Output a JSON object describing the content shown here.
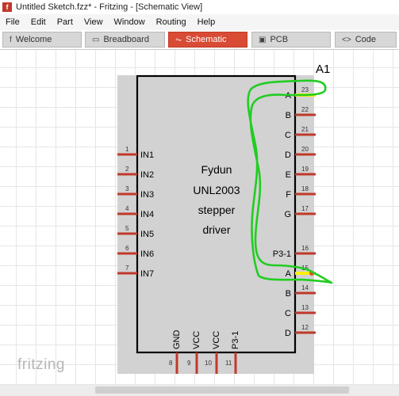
{
  "window": {
    "title": "Untitled Sketch.fzz* - Fritzing - [Schematic View]",
    "icon": "fritzing-icon"
  },
  "menu": [
    "File",
    "Edit",
    "Part",
    "View",
    "Window",
    "Routing",
    "Help"
  ],
  "tabs": [
    {
      "label": "Welcome",
      "icon": "f"
    },
    {
      "label": "Breadboard",
      "icon": "▭"
    },
    {
      "label": "Schematic",
      "icon": "⏦"
    },
    {
      "label": "PCB",
      "icon": "▣"
    },
    {
      "label": "Code",
      "icon": "<>"
    }
  ],
  "active_tab": "Schematic",
  "part": {
    "ref": "A1",
    "name_lines": [
      "Fydun",
      "UNL2003",
      "stepper",
      "driver"
    ],
    "left_pins": [
      {
        "num": "1",
        "label": "IN1"
      },
      {
        "num": "2",
        "label": "IN2"
      },
      {
        "num": "3",
        "label": "IN3"
      },
      {
        "num": "4",
        "label": "IN4"
      },
      {
        "num": "5",
        "label": "IN5"
      },
      {
        "num": "6",
        "label": "IN6"
      },
      {
        "num": "7",
        "label": "IN7"
      }
    ],
    "right_pins": [
      {
        "num": "23",
        "label": "A"
      },
      {
        "num": "22",
        "label": "B"
      },
      {
        "num": "21",
        "label": "C"
      },
      {
        "num": "20",
        "label": "D"
      },
      {
        "num": "19",
        "label": "E"
      },
      {
        "num": "18",
        "label": "F"
      },
      {
        "num": "17",
        "label": "G"
      },
      {
        "num": "16",
        "label": "P3-1"
      },
      {
        "num": "15",
        "label": "A"
      },
      {
        "num": "14",
        "label": "B"
      },
      {
        "num": "13",
        "label": "C"
      },
      {
        "num": "12",
        "label": "D"
      }
    ],
    "bottom_pins": [
      {
        "num": "8",
        "label": "GND"
      },
      {
        "num": "9",
        "label": "VCC"
      },
      {
        "num": "10",
        "label": "VCC"
      },
      {
        "num": "11",
        "label": "P3-1"
      }
    ]
  },
  "colors": {
    "pin": "#c0392b",
    "wire": "#22cc22",
    "highlight": "#ffee00",
    "accent": "#d84b35"
  },
  "logo": "fritzing"
}
